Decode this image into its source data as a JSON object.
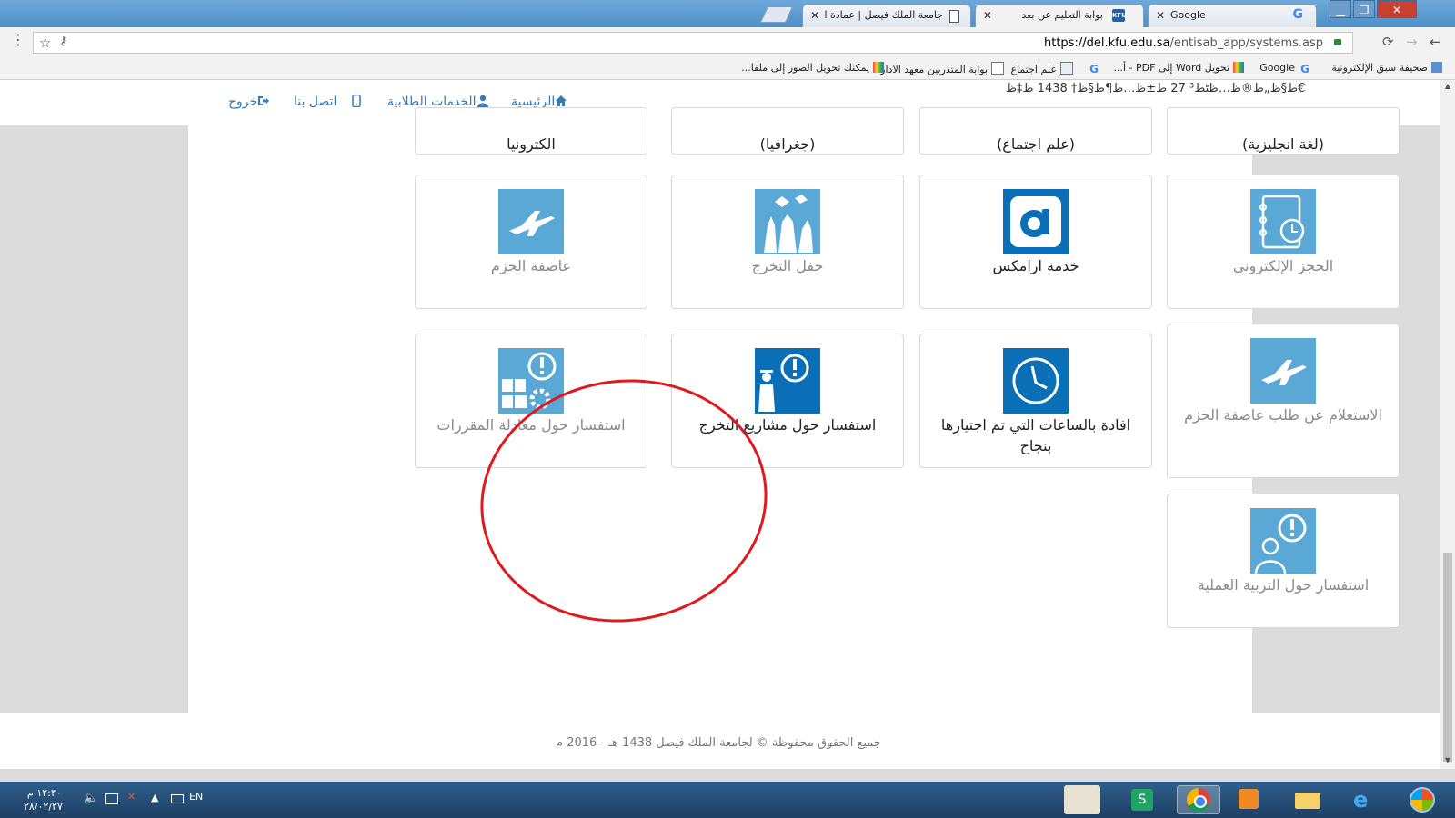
{
  "browser": {
    "tabs": [
      {
        "title": "جامعة الملك فيصل | عمادة التعلم",
        "active": false
      },
      {
        "title": "بوابة التعليم عن بعد",
        "favicon": "KFU",
        "active": true
      },
      {
        "title": "Google",
        "active": false
      }
    ],
    "url_host": "https://del.kfu.edu.sa",
    "url_path": "/entisab_app/systems.asp",
    "bookmarks": [
      "صحيفة سبق الإلكترونية",
      "Google",
      "تحويل Word إلى PDF - أ...",
      "علم اجتماع",
      "بوابة المتدربين معهد الادارة",
      "يمكنك تحويل الصور إلى ملفا..."
    ]
  },
  "header": {
    "date": "ط§ظ„ط®ظ…ظٹط³ 27 ط±ظ…ط¶ط§ظ† 1438 ظ‡ظ€",
    "nav": [
      {
        "label": "الرئيسية",
        "icon": "home-icon"
      },
      {
        "label": "الخدمات الطلابية",
        "icon": "user-icon"
      },
      {
        "label": "اتصل بنا",
        "icon": "mobile-icon"
      },
      {
        "label": "خروج",
        "icon": "logout-icon"
      }
    ]
  },
  "top_row": [
    "(لغة انجليزية)",
    "(علم اجتماع)",
    "(جغرافيا)",
    "الكترونيا"
  ],
  "services": [
    {
      "label": "الحجز الإلكتروني",
      "icon": "notebook-clock-icon",
      "enabled": false
    },
    {
      "label": "خدمة ارامكس",
      "icon": "aramex-logo-icon",
      "enabled": true
    },
    {
      "label": "حفل التخرج",
      "icon": "graduation-celebration-icon",
      "enabled": false
    },
    {
      "label": "عاصفة الحزم",
      "icon": "fighter-jet-icon",
      "enabled": false
    },
    {
      "label": "الاستعلام عن طلب عاصفة الحزم",
      "icon": "fighter-jet-icon",
      "enabled": false
    },
    {
      "label": "افادة بالساعات التي تم اجتيازها بنجاح",
      "icon": "clock-icon",
      "enabled": true
    },
    {
      "label": "استفسار حول مشاريع التخرج",
      "icon": "graduate-exclamation-icon",
      "enabled": true
    },
    {
      "label": "استفسار حول معادلة المقررات",
      "icon": "equation-exclamation-icon",
      "enabled": false
    },
    {
      "label": "استفسار حول التربية العملية",
      "icon": "teacher-exclamation-icon",
      "enabled": false
    }
  ],
  "footer": {
    "copyright": "جميع الحقوق محفوظة © لجامعة الملك فيصل 1438 هـ - 2016 م"
  },
  "taskbar": {
    "language": "EN",
    "time": "١٢:٣٠ م",
    "date": "٢٨/٠٢/٢٧"
  },
  "colors": {
    "enabled_tile": "#0a6fb7",
    "disabled_tile": "#5aa8d6",
    "annotation_circle": "#e0191f",
    "link": "#337ab7"
  }
}
